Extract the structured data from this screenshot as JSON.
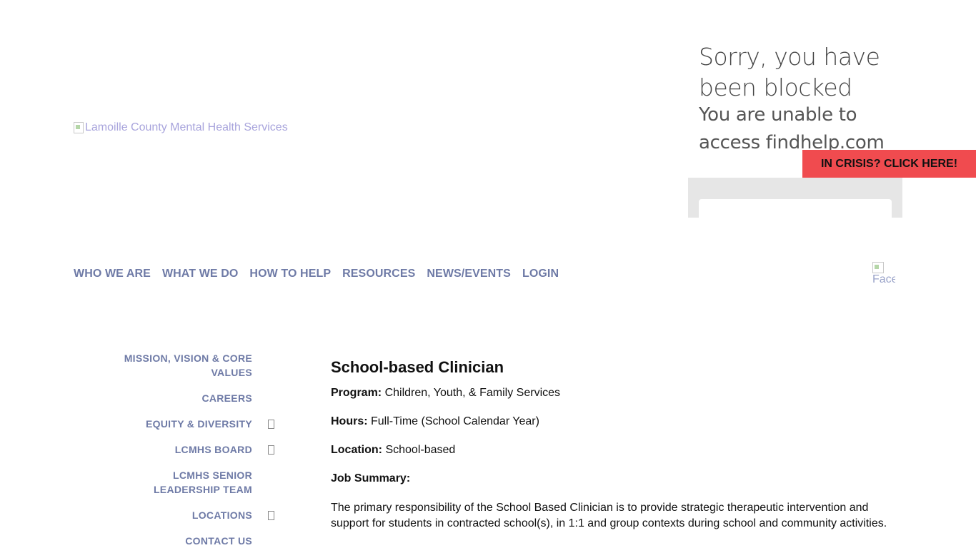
{
  "header": {
    "logo_alt": "Lamoille County Mental Health Services",
    "crisis_button": "IN CRISIS? CLICK HERE!",
    "facebook_alt": "Face"
  },
  "blocked_widget": {
    "title": "Sorry, you have been blocked",
    "subtitle": "You are unable to access findhelp.com"
  },
  "main_nav": [
    {
      "label": "WHO WE ARE"
    },
    {
      "label": "WHAT WE DO"
    },
    {
      "label": "HOW TO HELP"
    },
    {
      "label": "RESOURCES"
    },
    {
      "label": "NEWS/EVENTS"
    },
    {
      "label": "LOGIN"
    }
  ],
  "sidebar": {
    "items": [
      {
        "label": "MISSION, VISION & CORE VALUES",
        "expandable": false
      },
      {
        "label": "CAREERS",
        "expandable": false
      },
      {
        "label": "EQUITY & DIVERSITY",
        "expandable": true
      },
      {
        "label": "LCMHS BOARD",
        "expandable": true
      },
      {
        "label": "LCMHS SENIOR LEADERSHIP TEAM",
        "expandable": false
      },
      {
        "label": "LOCATIONS",
        "expandable": true
      },
      {
        "label": "CONTACT US",
        "expandable": false
      }
    ]
  },
  "job": {
    "title": "School-based Clinician",
    "program_label": "Program:",
    "program_value": " Children, Youth, & Family Services",
    "hours_label": "Hours:",
    "hours_value": " Full-Time (School Calendar Year)",
    "location_label": "Location:",
    "location_value": " School-based",
    "summary_heading": "Job Summary:",
    "summary_text": "The primary responsibility of the School Based Clinician is to provide strategic therapeutic intervention and support for students in contracted school(s), in 1:1 and group contexts during school and community activities."
  },
  "colors": {
    "nav": "#6e7aa6",
    "crisis_bg": "#f04b4f",
    "logo_alt_text": "#a8a4dc"
  }
}
